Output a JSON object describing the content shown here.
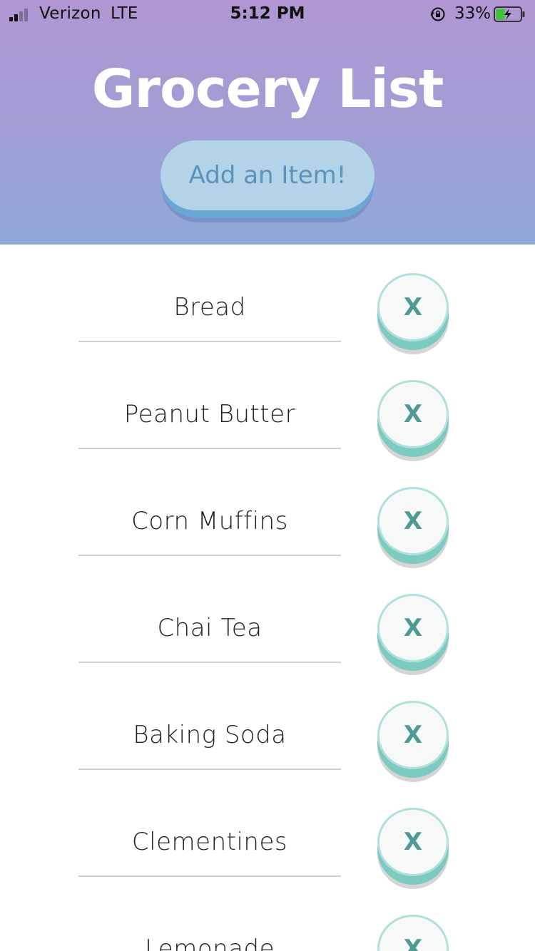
{
  "status_bar": {
    "carrier": "Verizon",
    "network": "LTE",
    "time": "5:12 PM",
    "battery_percent": "33%",
    "icons": [
      "signal-bars-icon",
      "rotation-lock-icon",
      "battery-charging-icon"
    ]
  },
  "header": {
    "title": "Grocery List",
    "add_button_label": "Add an Item!"
  },
  "colors": {
    "header_gradient_top": "#b196d3",
    "header_gradient_bottom": "#90a8d8",
    "add_button_fill": "#b3d3e8",
    "add_button_text": "#5c93bd",
    "delete_button_accent": "#7ccac0",
    "delete_button_text": "#4f9a91"
  },
  "list": {
    "delete_label": "X",
    "items": [
      {
        "name": "Bread"
      },
      {
        "name": "Peanut Butter"
      },
      {
        "name": "Corn Muffins"
      },
      {
        "name": "Chai Tea"
      },
      {
        "name": "Baking Soda"
      },
      {
        "name": "Clementines"
      },
      {
        "name": "Lemonade"
      }
    ]
  }
}
